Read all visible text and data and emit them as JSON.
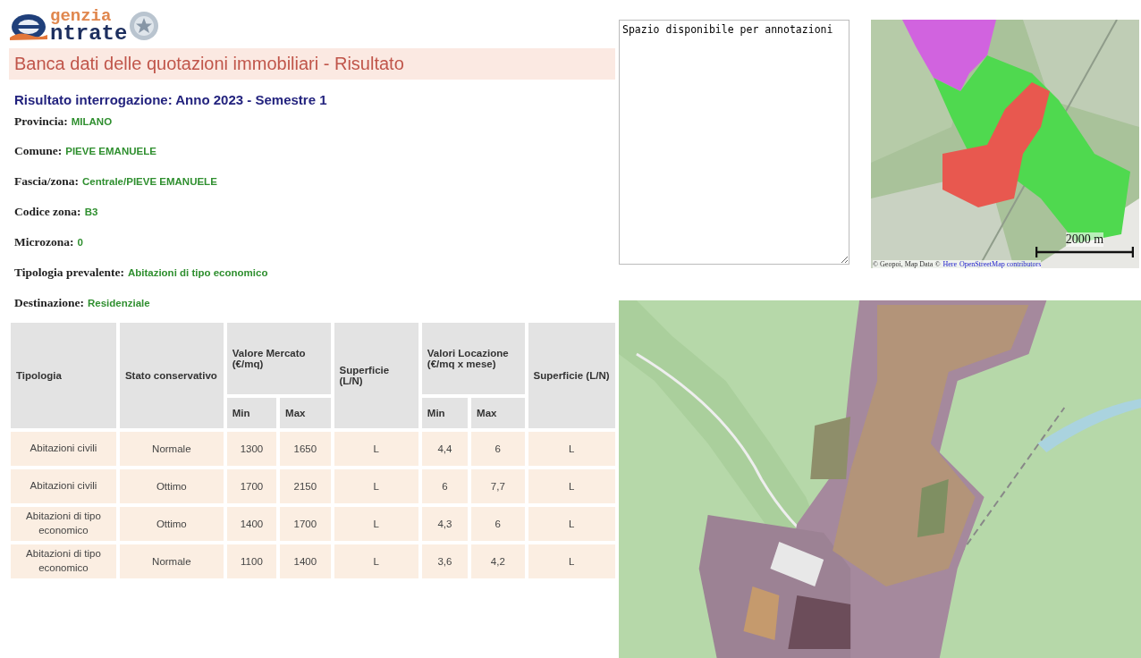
{
  "logo": {
    "line_1": "genzia",
    "line_2": "ntrate"
  },
  "page_title": "Banca dati delle quotazioni immobiliari - Risultato",
  "result_heading": "Risultato interrogazione: Anno 2023 - Semestre 1",
  "fields": [
    {
      "label": "Provincia:",
      "value": "MILANO"
    },
    {
      "label": "Comune:",
      "value": "PIEVE EMANUELE"
    },
    {
      "label": "Fascia/zona:",
      "value": "Centrale/PIEVE EMANUELE"
    },
    {
      "label": "Codice zona:",
      "value": "B3"
    },
    {
      "label": "Microzona:",
      "value": "0"
    },
    {
      "label": "Tipologia prevalente:",
      "value": "Abitazioni di tipo economico"
    },
    {
      "label": "Destinazione:",
      "value": "Residenziale"
    }
  ],
  "table": {
    "column_groups": [
      {
        "label": "Valore Mercato (€/mq)",
        "colspan": 2
      },
      {
        "label": "Valori Locazione (€/mq x mese)",
        "colspan": 2
      }
    ],
    "columns": [
      {
        "label": "Tipologia",
        "grouped": false
      },
      {
        "label": "Stato conservativo",
        "grouped": false
      },
      {
        "label": "Min",
        "grouped": true
      },
      {
        "label": "Max",
        "grouped": true
      },
      {
        "label": "Superficie (L/N)",
        "grouped": false
      },
      {
        "label": "Min",
        "grouped": true
      },
      {
        "label": "Max",
        "grouped": true
      },
      {
        "label": "Superficie (L/N)",
        "grouped": false
      }
    ],
    "rows": [
      [
        "Abitazioni civili",
        "Normale",
        "1300",
        "1650",
        "L",
        "4,4",
        "6",
        "L"
      ],
      [
        "Abitazioni civili",
        "Ottimo",
        "1700",
        "2150",
        "L",
        "6",
        "7,7",
        "L"
      ],
      [
        "Abitazioni di tipo economico",
        "Ottimo",
        "1400",
        "1700",
        "L",
        "4,3",
        "6",
        "L"
      ],
      [
        "Abitazioni di tipo economico",
        "Normale",
        "1100",
        "1400",
        "L",
        "3,6",
        "4,2",
        "L"
      ]
    ]
  },
  "notes": {
    "value": "Spazio disponibile per annotazioni"
  },
  "zone_map": {
    "kind": "picture",
    "scale": "2000 m",
    "attribution": "© Geopoi, Map Data ©",
    "links": [
      "Here",
      "OpenStreetMap contributors"
    ]
  }
}
